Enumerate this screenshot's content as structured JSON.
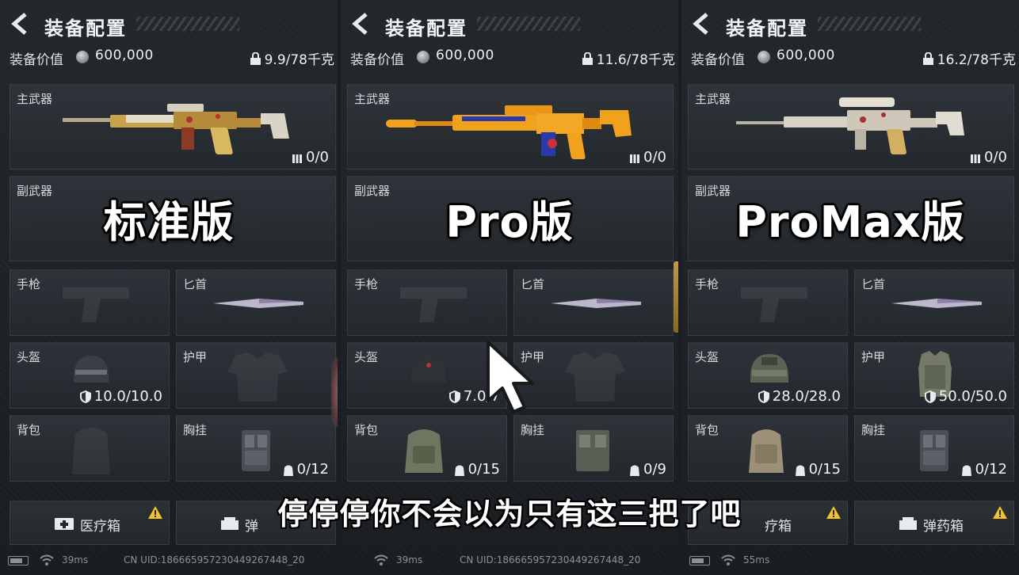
{
  "panels": [
    {
      "title": "装备配置",
      "value_label": "装备价值",
      "value": "600,000",
      "weight": "9.9/78千克",
      "edition": "标准版",
      "primary": {
        "label": "主武器",
        "ammo": "0/0"
      },
      "secondary": {
        "label": "副武器"
      },
      "pistol": {
        "label": "手枪"
      },
      "knife": {
        "label": "匕首"
      },
      "helmet": {
        "label": "头盔",
        "durability": "10.0/10.0"
      },
      "armor": {
        "label": "护甲",
        "durability": ""
      },
      "backpack": {
        "label": "背包",
        "capacity": ""
      },
      "rig": {
        "label": "胸挂",
        "capacity": "0/12"
      },
      "btn1": "医疗箱",
      "btn2": "弹",
      "ping": "39ms",
      "uid": "CN UID:18666595723044926744​8_20"
    },
    {
      "title": "装备配置",
      "value_label": "装备价值",
      "value": "600,000",
      "weight": "11.6/78千克",
      "edition": "Pro版",
      "primary": {
        "label": "主武器",
        "ammo": "0/0"
      },
      "secondary": {
        "label": "副武器"
      },
      "pistol": {
        "label": "手枪"
      },
      "knife": {
        "label": "匕首"
      },
      "helmet": {
        "label": "头盔",
        "durability": "7.0/7"
      },
      "armor": {
        "label": "护甲",
        "durability": ""
      },
      "backpack": {
        "label": "背包",
        "capacity": "0/15"
      },
      "rig": {
        "label": "胸挂",
        "capacity": "0/9"
      },
      "btn1": "",
      "btn2": "",
      "ping": "39ms",
      "uid": "CN UID:18666595723044926744​8_20"
    },
    {
      "title": "装备配置",
      "value_label": "装备价值",
      "value": "600,000",
      "weight": "16.2/78千克",
      "edition": "ProMax版",
      "primary": {
        "label": "主武器",
        "ammo": "0/0"
      },
      "secondary": {
        "label": "副武器"
      },
      "pistol": {
        "label": "手枪"
      },
      "knife": {
        "label": "匕首"
      },
      "helmet": {
        "label": "头盔",
        "durability": "28.0/28.0"
      },
      "armor": {
        "label": "护甲",
        "durability": "50.0/50.0"
      },
      "backpack": {
        "label": "背包",
        "capacity": "0/15"
      },
      "rig": {
        "label": "胸挂",
        "capacity": "0/12"
      },
      "btn1": "疗箱",
      "btn2": "弹药箱",
      "ping": "55ms",
      "uid": ""
    }
  ],
  "subtitle": "停停停你不会以为只有这三把了吧",
  "colors": {
    "gun1": "#c9a24a",
    "gun2": "#f0a21e",
    "gun2_accent": "#2a3aa8",
    "gun3": "#d8d2c6",
    "warning": "#f2c230",
    "edition_text": "#ffffff"
  },
  "icons": [
    "back-arrow-icon",
    "coin-icon",
    "lock-icon",
    "ammo-icon",
    "shield-icon",
    "backpack-capacity-icon",
    "medkit-icon",
    "ammo-box-icon",
    "warning-icon",
    "wifi-icon",
    "battery-icon",
    "cursor-arrow-icon"
  ]
}
